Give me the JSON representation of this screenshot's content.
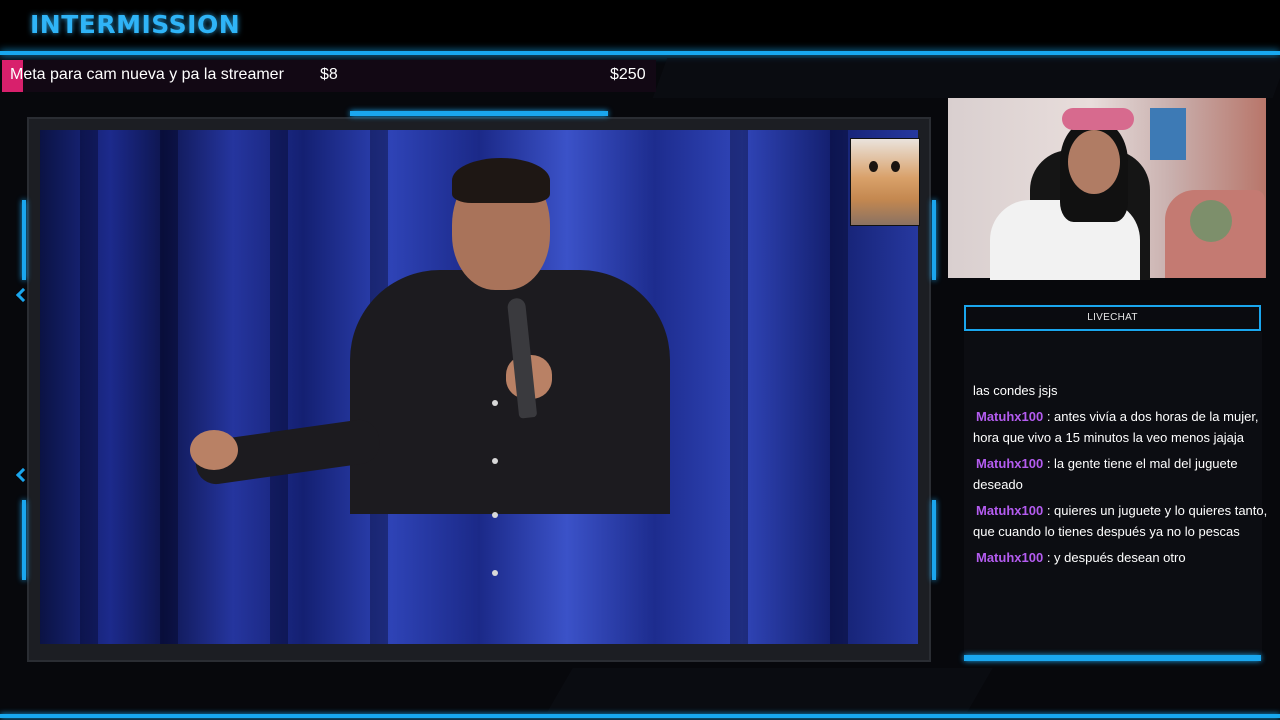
{
  "header": {
    "title": "INTERMISSION"
  },
  "goal": {
    "label": "Meta para cam nueva y pa la streamer",
    "current": "$8",
    "target": "$250",
    "progress": 0.032,
    "fill_color": "#d8206c"
  },
  "chat": {
    "header": "LIVECHAT",
    "messages": [
      {
        "user": "",
        "text": "las condes jsjs"
      },
      {
        "user": "Matuhx100",
        "text": " : antes vivía a dos horas de la mujer, hora que vivo a 15 minutos la veo menos jajaja"
      },
      {
        "user": "Matuhx100",
        "text": " : la gente tiene el mal del juguete deseado"
      },
      {
        "user": "Matuhx100",
        "text": " : quieres un juguete y lo quieres tanto, que cuando lo tienes después ya no lo pescas"
      },
      {
        "user": "Matuhx100",
        "text": " : y después desean otro"
      }
    ]
  },
  "colors": {
    "accent": "#1aa6ee",
    "title": "#2fb4f7",
    "username": "#b45cf0"
  }
}
